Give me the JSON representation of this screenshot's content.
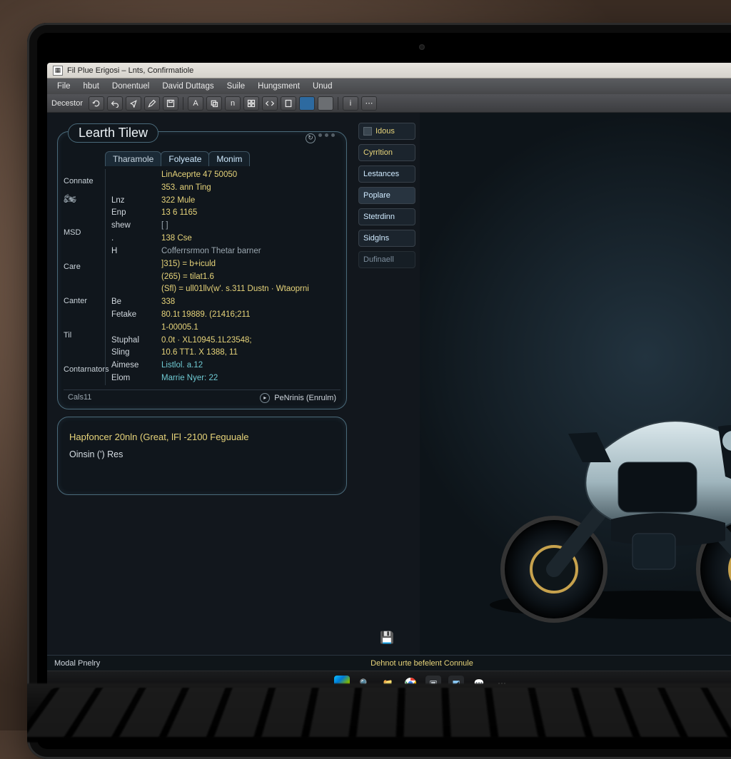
{
  "titlebar": {
    "title": "Fil Plue Erigosi – Lnts, Confirmatiole"
  },
  "menubar": [
    "File",
    "hbut",
    "Donentuel",
    "David Duttags",
    "Suile",
    "Hungsment",
    "Unud"
  ],
  "toolbar": {
    "label": "Decestor",
    "buttons": [
      {
        "name": "refresh-icon"
      },
      {
        "name": "undo-icon"
      },
      {
        "name": "share-icon"
      },
      {
        "name": "edit-icon"
      },
      {
        "name": "save-icon"
      },
      {
        "name": "font-icon",
        "text": "A"
      },
      {
        "name": "copy-icon"
      },
      {
        "name": "bold-icon",
        "text": "n"
      },
      {
        "name": "grid-icon"
      },
      {
        "name": "code-icon"
      },
      {
        "name": "doc-icon"
      },
      {
        "name": "fill-icon"
      },
      {
        "name": "clear-icon"
      },
      {
        "name": "info-icon"
      },
      {
        "name": "more-icon"
      }
    ]
  },
  "properties": {
    "title": "Learth Tilew",
    "tabs": [
      "Tharamole",
      "Folyeate",
      "Monim"
    ],
    "side": [
      "Connate",
      "",
      "",
      "MSD",
      "",
      "Care",
      "",
      "Canter",
      "",
      "Til",
      "",
      "Contarnators"
    ],
    "rows": [
      {
        "k": "",
        "v": "LinAceprte 47 50050",
        "cls": "v"
      },
      {
        "k": "",
        "v": "353. ann Ting",
        "cls": "v"
      },
      {
        "k": "Lnz",
        "v": "322 Mule",
        "cls": "v"
      },
      {
        "k": "Enp",
        "v": "13 6 1165",
        "cls": "v"
      },
      {
        "k": "shew",
        "v": "[ ]",
        "cls": "v gray"
      },
      {
        "k": ".",
        "v": "138 Cse",
        "cls": "v"
      },
      {
        "k": "H",
        "v": "Cofferrsrmon Thetar barner",
        "cls": "v gray"
      },
      {
        "k": "",
        "v": "]315) = b+iculd",
        "cls": "v"
      },
      {
        "k": "",
        "v": "(265) = tilat1.6",
        "cls": "v"
      },
      {
        "k": "",
        "v": "(Sfl) = ull01llv(w'. s.311 Dustn · Wtaoprni",
        "cls": "v"
      },
      {
        "k": "Be",
        "v": "338",
        "cls": "v"
      },
      {
        "k": "Fetake",
        "v": "80.1t 19889. (21416;211",
        "cls": "v"
      },
      {
        "k": "",
        "v": "1-00005.1",
        "cls": "v"
      },
      {
        "k": "Stuphal",
        "v": "0.0t · XL10945.1L23548;",
        "cls": "v"
      },
      {
        "k": "Sling",
        "v": "10.6 TT1. X 1388, 11",
        "cls": "v"
      },
      {
        "k": "Aimese",
        "v": "Listlol. a.12",
        "cls": "v teal"
      },
      {
        "k": "Elom",
        "v": "Marrie Nyer: 22",
        "cls": "v teal"
      }
    ],
    "footer_left": "Cals11",
    "footer_btn": "PeNrinis (Enrulm)"
  },
  "mid_buttons": [
    {
      "label": "Idous",
      "style": "yellow"
    },
    {
      "label": "Cyrrltion",
      "style": "yellow"
    },
    {
      "label": "Lestances",
      "style": ""
    },
    {
      "label": "Poplare",
      "style": "sel"
    },
    {
      "label": "Stetrdinn",
      "style": ""
    },
    {
      "label": "Sidglns",
      "style": ""
    },
    {
      "label": "Dufinaell",
      "style": ""
    }
  ],
  "output": {
    "msg1": "Hapfoncer 20nln (Great, lFl -2100 Feguuale",
    "msg2": "Oinsin (') Res"
  },
  "statusbar": {
    "left": "Modal Pnelry",
    "center": "Dehnot urte befelent Connule"
  },
  "taskbar_apps": [
    "start",
    "search",
    "files",
    "chrome",
    "app",
    "active",
    "msg",
    "more"
  ]
}
